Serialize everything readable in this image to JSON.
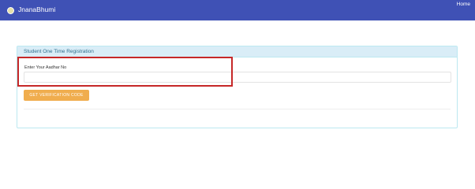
{
  "navbar": {
    "brand": "JnanaBhumi",
    "home_link": "Home",
    "logo_icon": "emblem-logo-icon"
  },
  "panel": {
    "title": "Student One Time Registration",
    "aadhar_label": "Enter Your Aadhar No",
    "aadhar_value": "",
    "verify_button": "GET VERIFICATION CODE"
  },
  "colors": {
    "navbar": "#3f51b5",
    "panel_heading": "#d9edf7",
    "button": "#f0ad4e",
    "highlight": "#c62828"
  }
}
